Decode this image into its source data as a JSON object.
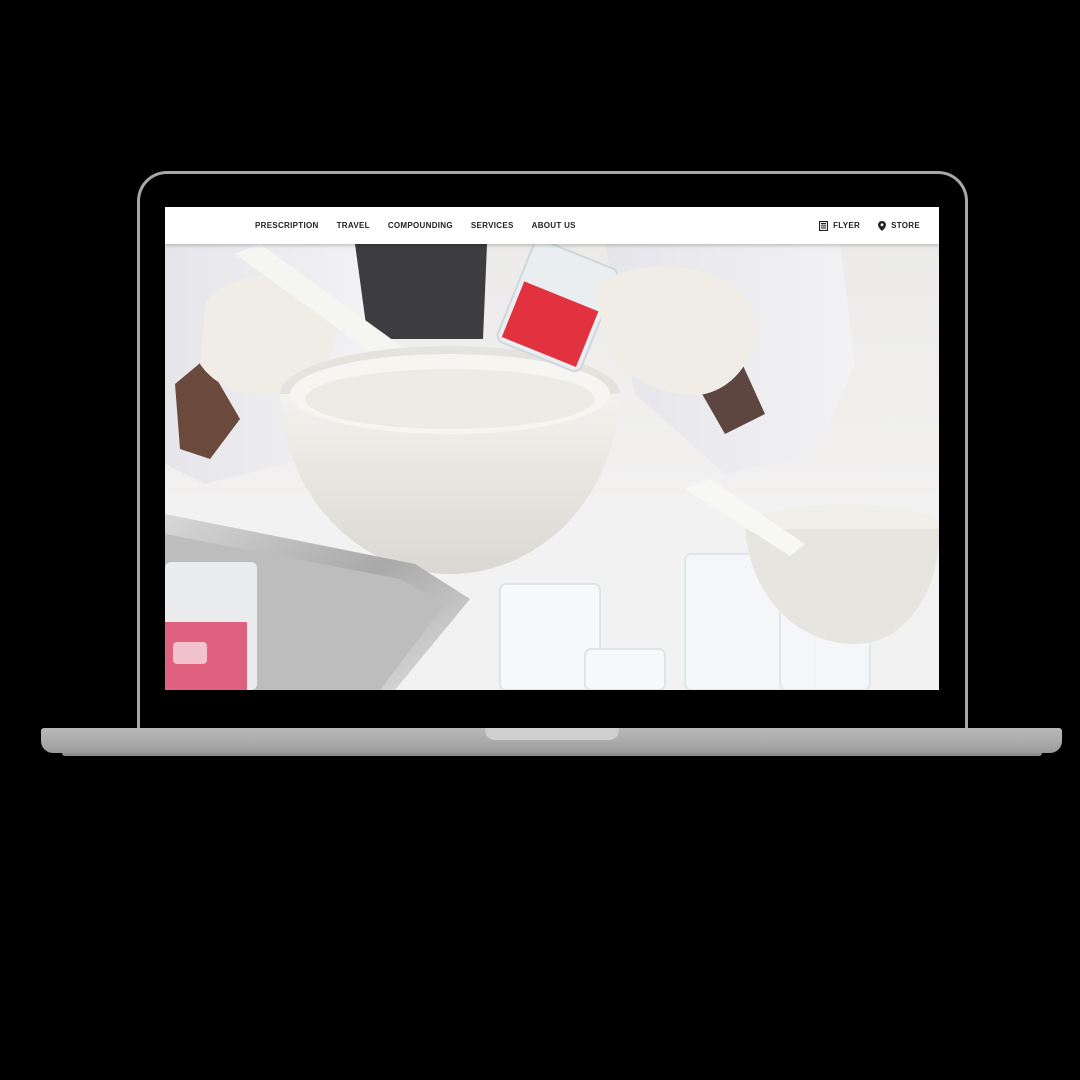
{
  "nav": {
    "links": [
      "PRESCRIPTION",
      "TRAVEL",
      "COMPOUNDING",
      "SERVICES",
      "ABOUT US"
    ],
    "flyer": {
      "label": "FLYER",
      "icon": "flyer-icon"
    },
    "store": {
      "label": "STORE",
      "icon": "map-pin-icon"
    }
  },
  "colors": {
    "nav_bg": "#ffffff",
    "nav_text": "#222222",
    "bezel": "#a7a7a7",
    "background": "#000000",
    "powder_red": "#e2323f",
    "powder_pink": "#e0607f"
  }
}
